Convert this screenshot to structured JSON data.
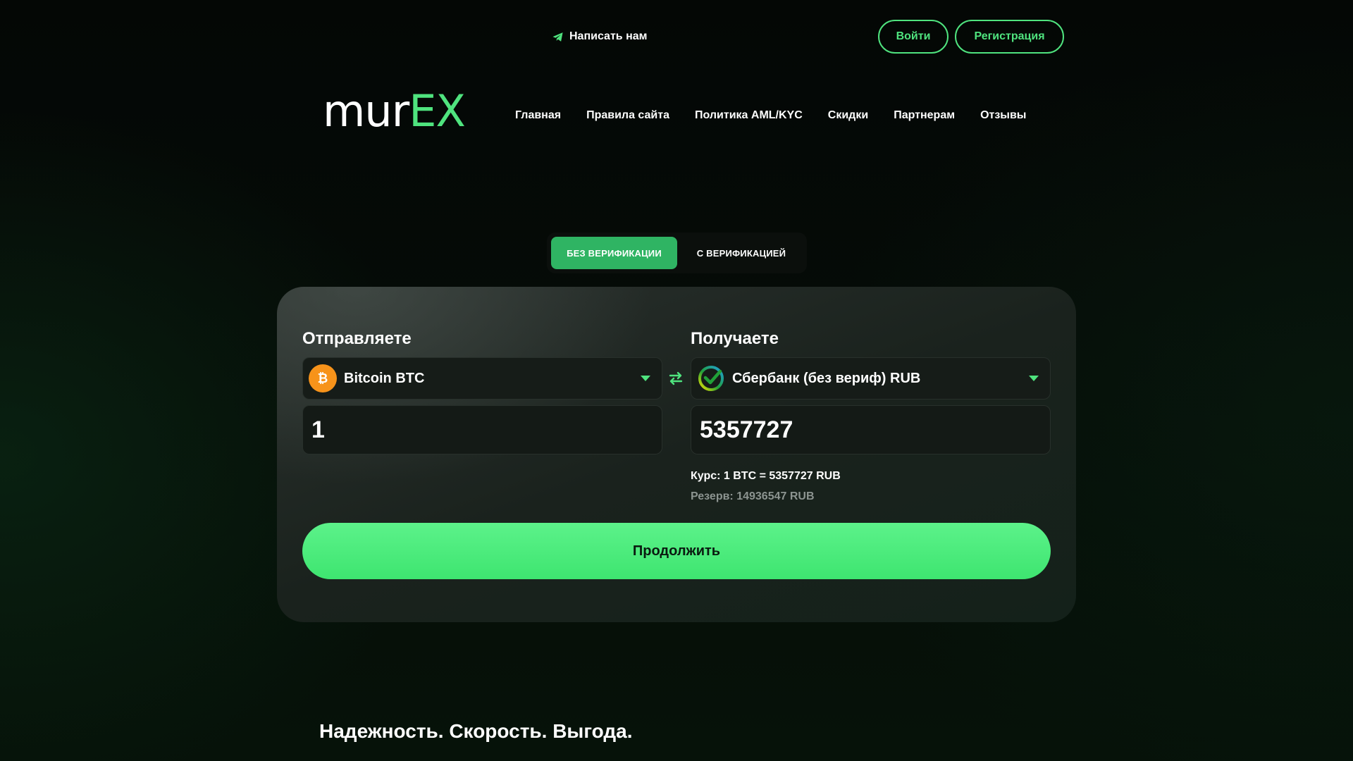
{
  "topbar": {
    "contact_label": "Написать нам",
    "login_label": "Войти",
    "register_label": "Регистрация"
  },
  "brand": {
    "logo_white": "mur",
    "logo_green": "EX",
    "accent_color": "#4fe37e"
  },
  "nav": {
    "items": [
      {
        "label": "Главная"
      },
      {
        "label": "Правила сайта"
      },
      {
        "label": "Политика AML/KYC"
      },
      {
        "label": "Скидки"
      },
      {
        "label": "Партнерам"
      },
      {
        "label": "Отзывы"
      }
    ]
  },
  "verification_toggle": {
    "options": [
      {
        "label": "БЕЗ ВЕРИФИКАЦИИ",
        "active": true
      },
      {
        "label": "С ВЕРИФИКАЦИЕЙ",
        "active": false
      }
    ]
  },
  "exchange": {
    "send": {
      "title": "Отправляете",
      "currency": "Bitcoin BTC",
      "currency_icon": "bitcoin-icon",
      "amount": "1"
    },
    "receive": {
      "title": "Получаете",
      "currency": "Сбербанк (без вериф) RUB",
      "currency_icon": "sberbank-icon",
      "amount": "5357727"
    },
    "swap_icon": "swap-arrows-icon",
    "rate_text": "Курс: 1 BTC = 5357727 RUB",
    "reserve_text": "Резерв: 14936547 RUB",
    "continue_label": "Продолжить"
  },
  "tagline": "Надежность. Скорость. Выгода."
}
